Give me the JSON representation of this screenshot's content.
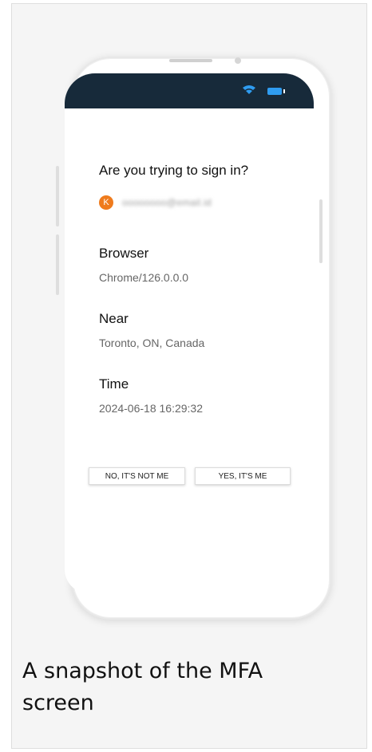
{
  "screen": {
    "title": "Are you trying to sign in?",
    "account": {
      "avatar_letter": "K",
      "email": "oooooooo@email.id",
      "avatar_color": "#ef7b1d"
    },
    "details": [
      {
        "label": "Browser",
        "value": "Chrome/126.0.0.0"
      },
      {
        "label": "Near",
        "value": "Toronto, ON, Canada"
      },
      {
        "label": "Time",
        "value": "2024-06-18 16:29:32"
      }
    ],
    "buttons": {
      "deny": "NO, IT'S NOT ME",
      "approve": "YES, IT'S ME"
    },
    "status_bar": {
      "color": "#172a3a",
      "icons": [
        "wifi-icon",
        "battery-icon"
      ]
    }
  },
  "caption": "A snapshot of the MFA screen"
}
